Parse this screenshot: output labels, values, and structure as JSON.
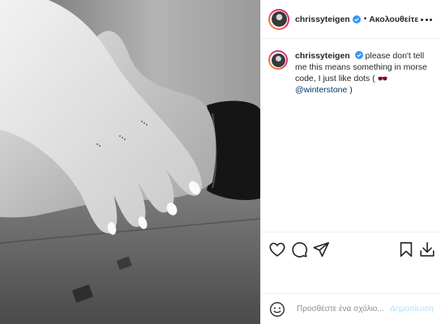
{
  "post": {
    "author": {
      "username": "chrissyteigen",
      "verified": true,
      "follow_label": "Ακολουθείτε",
      "separator": "•"
    },
    "caption": {
      "username": "chrissyteigen",
      "text_before_emoji": "please don't tell me this means something in morse code, I just like dots (",
      "emoji": "sunglasses-emoji",
      "mention": "@winterstone",
      "text_after_mention": " )"
    },
    "actions": {
      "like_icon": "heart-icon",
      "comment_icon": "comment-icon",
      "share_icon": "share-icon",
      "save_icon": "bookmark-icon",
      "download_icon": "download-icon"
    },
    "add_comment": {
      "placeholder": "Προσθέστε ένα σχόλιο...",
      "post_label": "Δημοσίευση"
    },
    "colors": {
      "text": "#262626",
      "link": "#00376b",
      "verified": "#3897f0",
      "post_button_disabled": "#b2dffc",
      "placeholder": "#8e8e8e",
      "border": "#efefef"
    }
  }
}
